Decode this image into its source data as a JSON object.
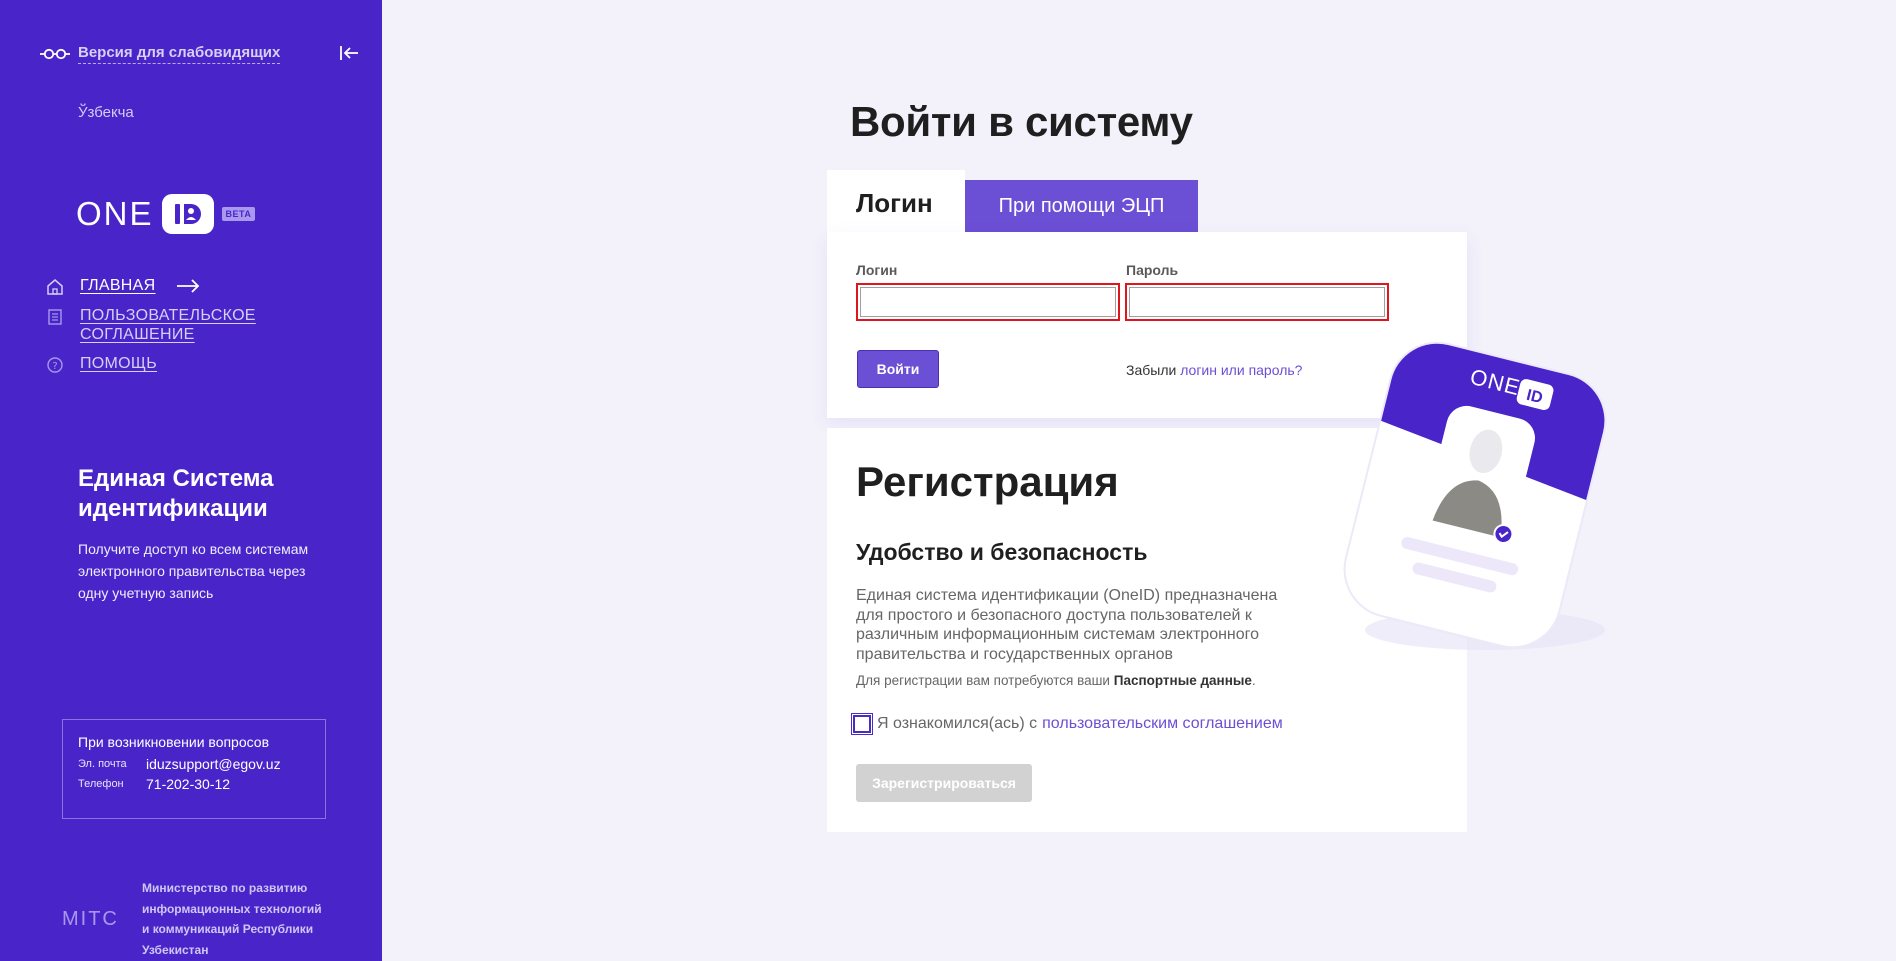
{
  "sidebar": {
    "a11y_link": "Версия для слабовидящих",
    "language": "Ўзбекча",
    "logo": {
      "text": "ONE",
      "mark": "ID",
      "badge": "BETA"
    },
    "nav": [
      {
        "label": "ГЛАВНАЯ",
        "icon": "home-icon",
        "active": true
      },
      {
        "label": "ПОЛЬЗОВАТЕЛЬСКОЕ",
        "label2": "СОГЛАШЕНИЕ",
        "icon": "document-icon",
        "active": false
      },
      {
        "label": "ПОМОЩЬ",
        "icon": "help-icon",
        "active": false
      }
    ],
    "info_title": "Единая Система идентификации",
    "info_text": "Получите доступ ко всем системам электронного правительства через одну учетную запись",
    "contact": {
      "title": "При возникновении вопросов",
      "email_label": "Эл. почта",
      "email": "iduzsupport@egov.uz",
      "phone_label": "Телефон",
      "phone": "71-202-30-12"
    },
    "ministry_logo": "MITC",
    "ministry": "Министерство по развитию информационных технологий и коммуникаций Республики Узбекистан"
  },
  "main": {
    "title": "Войти в систему",
    "tabs": [
      {
        "label": "Логин",
        "active": true
      },
      {
        "label": "При помощи ЭЦП",
        "active": false
      }
    ],
    "login": {
      "login_label": "Логин",
      "login_value": "",
      "password_label": "Пароль",
      "password_value": "",
      "submit": "Войти",
      "forgot_prefix": "Забыли",
      "forgot_link": "логин или пароль?"
    },
    "registration": {
      "title": "Регистрация",
      "subtitle": "Удобство и безопасность",
      "description": "Единая система идентификации (OneID) предназначена для простого и безопасного доступа пользователей к различным информационным системам электронного правительства и государственных органов",
      "note_prefix": "Для регистрации вам потребуются ваши",
      "note_bold": "Паспортные данные",
      "note_suffix": ".",
      "agree_prefix": "Я ознакомился(ась) с",
      "agree_link": "пользовательским соглашением",
      "agree_checked": false,
      "register_button": "Зарегистрироваться"
    },
    "illustration": {
      "text": "ONE",
      "mark": "ID"
    }
  },
  "colors": {
    "sidebar": "#4925c9",
    "accent": "#6b4fd4",
    "background": "#f3f2fa",
    "error_border": "#e0161e",
    "disabled": "#d2d2d2"
  }
}
